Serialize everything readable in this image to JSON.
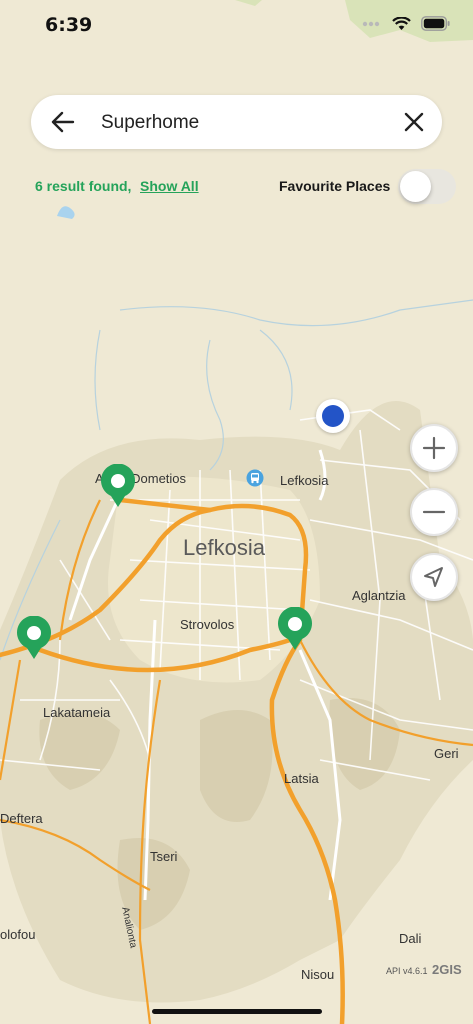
{
  "status_bar": {
    "time": "6:39"
  },
  "search": {
    "value": "Superhome"
  },
  "results": {
    "count_text": "6 result found,",
    "show_all": "Show All"
  },
  "favourites": {
    "label": "Favourite Places",
    "enabled": false
  },
  "map_labels": {
    "agios_dometios": "Agios Dometios",
    "lefkosia_small": "Lefkosia",
    "lefkosia_large": "Lefkosia",
    "aglantzia": "Aglantzia",
    "strovolos": "Strovolos",
    "lakatameia": "Lakatameia",
    "geri": "Geri",
    "latsia": "Latsia",
    "deftera": "Deftera",
    "tseri": "Tseri",
    "analionta": "Analionta",
    "olofou": "olofou",
    "dali": "Dali",
    "nisou": "Nisou"
  },
  "attribution": {
    "api_version": "API v4.6.1",
    "logo": "2GIS"
  },
  "colors": {
    "accent_green": "#25a35a",
    "road_orange": "#f2a02c",
    "user_blue": "#2354c7",
    "map_bg": "#efe9d4"
  }
}
